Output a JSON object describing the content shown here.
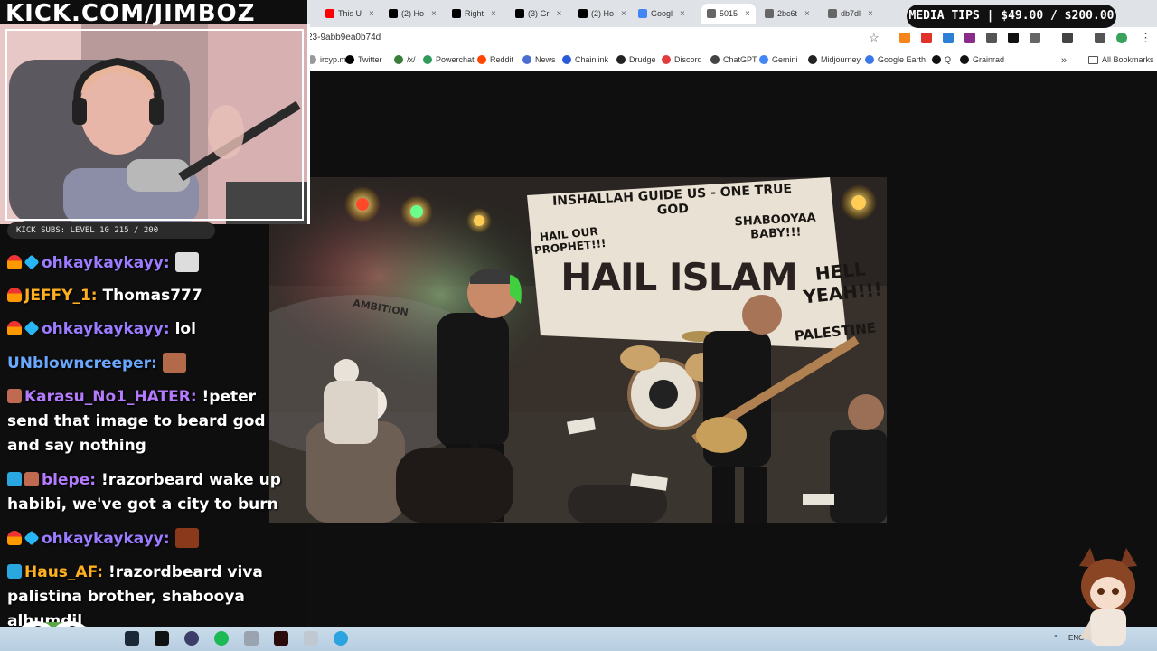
{
  "overlay": {
    "kick_url": "KICK.COM/JIMBOZ",
    "subs_badge": "KICK SUBS: LEVEL 10 215 / 200",
    "media_tips": "MEDIA TIPS | $49.00 / $200.00"
  },
  "browser": {
    "tabs": [
      {
        "label": "This U",
        "icon": "youtube-icon",
        "color": "#ff0000"
      },
      {
        "label": "(2) Ho",
        "icon": "x-icon",
        "color": "#000000"
      },
      {
        "label": "Right",
        "icon": "x-icon",
        "color": "#000000"
      },
      {
        "label": "(3) Gr",
        "icon": "x-icon",
        "color": "#000000"
      },
      {
        "label": "(2) Ho",
        "icon": "x-icon",
        "color": "#000000"
      },
      {
        "label": "Googl",
        "icon": "gemini-icon",
        "color": "#4285f4"
      },
      {
        "label": "5015",
        "icon": "globe-icon",
        "color": "#666666",
        "active": true
      },
      {
        "label": "2bc6t",
        "icon": "globe-icon",
        "color": "#666666"
      },
      {
        "label": "db7dl",
        "icon": "globe-icon",
        "color": "#666666"
      }
    ],
    "url": "23-9abb9ea0b74d",
    "bookmarks": [
      {
        "label": "ircyp.me",
        "icon": "link-icon",
        "color": "#999999"
      },
      {
        "label": "Twitter",
        "icon": "x-icon",
        "color": "#000000"
      },
      {
        "label": "/x/",
        "icon": "fourchan-icon",
        "color": "#3a7d3a"
      },
      {
        "label": "Powerchat",
        "icon": "powerchat-icon",
        "color": "#2e9b5a"
      },
      {
        "label": "Reddit",
        "icon": "reddit-icon",
        "color": "#ff4500"
      },
      {
        "label": "News",
        "icon": "news-icon",
        "color": "#4a6fd0"
      },
      {
        "label": "Chainlink",
        "icon": "chainlink-icon",
        "color": "#2a5ada"
      },
      {
        "label": "Drudge",
        "icon": "drudge-icon",
        "color": "#222222"
      },
      {
        "label": "Discord",
        "icon": "discord-icon",
        "color": "#e23b3b"
      },
      {
        "label": "ChatGPT",
        "icon": "chatgpt-icon",
        "color": "#444444"
      },
      {
        "label": "Gemini",
        "icon": "gemini-icon",
        "color": "#4285f4"
      },
      {
        "label": "Midjourney",
        "icon": "midjourney-icon",
        "color": "#222222"
      },
      {
        "label": "Google Earth",
        "icon": "earth-icon",
        "color": "#3b78e7"
      },
      {
        "label": "Q",
        "icon": "q-icon",
        "color": "#111111"
      },
      {
        "label": "Grainrad",
        "icon": "grainrad-icon",
        "color": "#111111"
      }
    ],
    "all_bookmarks": "All Bookmarks"
  },
  "image": {
    "banner_line1": "INSHALLAH GUIDE US - ONE TRUE GOD",
    "banner_left": "HAIL OUR PROPHET!!!",
    "banner_right": "SHABOOYAA BABY!!!",
    "banner_main": "HAIL ISLAM",
    "banner_hell": "HELL YEAH!!!",
    "banner_palestine": "PALESTINE",
    "wall_graffiti": "AMBITION"
  },
  "chat": [
    {
      "user": "ohkaykaykayy:",
      "text": "",
      "color": "#9b7bff",
      "badges": [
        "fire",
        "cube"
      ],
      "emote": "clap-emote"
    },
    {
      "user": "JEFFY_1:",
      "text": "Thomas777",
      "color": "#ffb020",
      "badges": [
        "fire"
      ]
    },
    {
      "user": "ohkaykaykayy:",
      "text": "lol",
      "color": "#9b7bff",
      "badges": [
        "fire",
        "cube"
      ]
    },
    {
      "user": "UNblowncreeper:",
      "text": "",
      "color": "#6aa8ff",
      "badges": [],
      "emote": "face-emote"
    },
    {
      "user": "Karasu_No1_HATER:",
      "text": "!peter send that image to beard god and say nothing",
      "color": "#b57bff",
      "badges": [
        "pix"
      ]
    },
    {
      "user": "blepe:",
      "text": "!razorbeard wake up habibi, we've got a city to burn",
      "color": "#b57bff",
      "badges": [
        "bot",
        "pix"
      ]
    },
    {
      "user": "ohkaykaykayy:",
      "text": "",
      "color": "#9b7bff",
      "badges": [
        "fire",
        "cube"
      ],
      "emote": "apple-emote"
    },
    {
      "user": "Haus_AF:",
      "text": "!razordbeard viva palistina brother, shabooya alhumdil",
      "color": "#ffb020",
      "badges": [
        "bot"
      ]
    }
  ],
  "taskbar": {
    "lang": "ENG"
  },
  "colors": {
    "page_bg": "#0e0e0e",
    "chrome_bg": "#dfe3e8",
    "taskbar_bg": "#c9dcea"
  }
}
